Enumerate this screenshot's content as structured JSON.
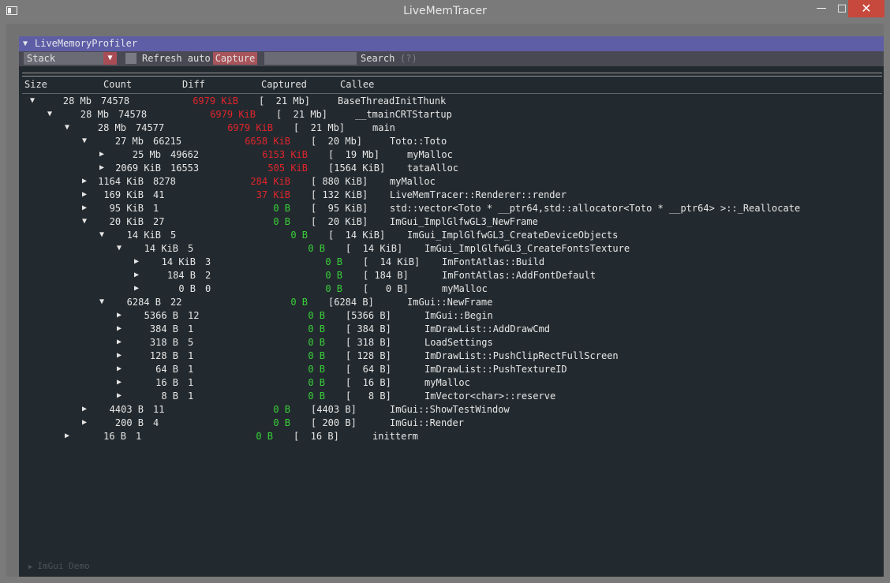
{
  "window": {
    "title": "LiveMemTracer",
    "minimize_icon": "minimize-icon",
    "maximize_icon": "maximize-icon",
    "close_icon": "close-icon"
  },
  "panel": {
    "title": "LiveMemoryProfiler",
    "collapse_icon": "triangle-down-icon"
  },
  "toolbar": {
    "stack_value": "Stack",
    "refresh_label": "Refresh auto",
    "refresh_checked": false,
    "capture_label": "Capture",
    "search_value": "",
    "search_label": "Search",
    "search_help": "(?)"
  },
  "columns": [
    "Size",
    "Count",
    "Diff",
    "Captured",
    "Callee"
  ],
  "colors": {
    "negative": "#e0242c",
    "zero": "#38d038",
    "header": "#5e5ea6",
    "capture": "#a8545b"
  },
  "rows": [
    {
      "depth": 0,
      "expanded": true,
      "size": "28 Mb",
      "count": "74578",
      "diff": "6979 KiB",
      "diff_kind": "neg",
      "captured": "[  21 Mb]",
      "callee": "BaseThreadInitThunk"
    },
    {
      "depth": 1,
      "expanded": true,
      "size": "28 Mb",
      "count": "74578",
      "diff": "6979 KiB",
      "diff_kind": "neg",
      "captured": "[  21 Mb]",
      "callee": "__tmainCRTStartup"
    },
    {
      "depth": 2,
      "expanded": true,
      "size": "28 Mb",
      "count": "74577",
      "diff": "6979 KiB",
      "diff_kind": "neg",
      "captured": "[  21 Mb]",
      "callee": "main"
    },
    {
      "depth": 3,
      "expanded": true,
      "size": "27 Mb",
      "count": "66215",
      "diff": "6658 KiB",
      "diff_kind": "neg",
      "captured": "[  20 Mb]",
      "callee": "Toto::Toto"
    },
    {
      "depth": 4,
      "expanded": false,
      "size": "25 Mb",
      "count": "49662",
      "diff": "6153 KiB",
      "diff_kind": "neg",
      "captured": "[  19 Mb]",
      "callee": "myMalloc"
    },
    {
      "depth": 4,
      "expanded": false,
      "size": "2069 KiB",
      "count": "16553",
      "diff": "505 KiB",
      "diff_kind": "neg",
      "captured": "[1564 KiB]",
      "callee": "tataAlloc"
    },
    {
      "depth": 3,
      "expanded": false,
      "size": "1164 KiB",
      "count": "8278",
      "diff": "284 KiB",
      "diff_kind": "neg",
      "captured": "[ 880 KiB]",
      "callee": "myMalloc"
    },
    {
      "depth": 3,
      "expanded": false,
      "size": "169 KiB",
      "count": "41",
      "diff": "37 KiB",
      "diff_kind": "neg",
      "captured": "[ 132 KiB]",
      "callee": "LiveMemTracer::Renderer::render"
    },
    {
      "depth": 3,
      "expanded": false,
      "size": "95 KiB",
      "count": "1",
      "diff": "0 B",
      "diff_kind": "pos",
      "captured": "[  95 KiB]",
      "callee": "std::vector<Toto * __ptr64,std::allocator<Toto * __ptr64> >::_Reallocate"
    },
    {
      "depth": 3,
      "expanded": true,
      "size": "20 KiB",
      "count": "27",
      "diff": "0 B",
      "diff_kind": "pos",
      "captured": "[  20 KiB]",
      "callee": "ImGui_ImplGlfwGL3_NewFrame"
    },
    {
      "depth": 4,
      "expanded": true,
      "size": "14 KiB",
      "count": "5",
      "diff": "0 B",
      "diff_kind": "pos",
      "captured": "[  14 KiB]",
      "callee": "ImGui_ImplGlfwGL3_CreateDeviceObjects"
    },
    {
      "depth": 5,
      "expanded": true,
      "size": "14 KiB",
      "count": "5",
      "diff": "0 B",
      "diff_kind": "pos",
      "captured": "[  14 KiB]",
      "callee": "ImGui_ImplGlfwGL3_CreateFontsTexture"
    },
    {
      "depth": 6,
      "expanded": false,
      "size": "14 KiB",
      "count": "3",
      "diff": "0 B",
      "diff_kind": "pos",
      "captured": "[  14 KiB]",
      "callee": "ImFontAtlas::Build"
    },
    {
      "depth": 6,
      "expanded": false,
      "size": "184 B",
      "count": "2",
      "diff": "0 B",
      "diff_kind": "pos",
      "captured": "[ 184 B]",
      "callee": "ImFontAtlas::AddFontDefault"
    },
    {
      "depth": 6,
      "expanded": false,
      "size": "0 B",
      "count": "0",
      "diff": "0 B",
      "diff_kind": "pos",
      "captured": "[   0 B]",
      "callee": "myMalloc"
    },
    {
      "depth": 4,
      "expanded": true,
      "size": "6284 B",
      "count": "22",
      "diff": "0 B",
      "diff_kind": "pos",
      "captured": "[6284 B]",
      "callee": "ImGui::NewFrame"
    },
    {
      "depth": 5,
      "expanded": false,
      "size": "5366 B",
      "count": "12",
      "diff": "0 B",
      "diff_kind": "pos",
      "captured": "[5366 B]",
      "callee": "ImGui::Begin"
    },
    {
      "depth": 5,
      "expanded": false,
      "size": "384 B",
      "count": "1",
      "diff": "0 B",
      "diff_kind": "pos",
      "captured": "[ 384 B]",
      "callee": "ImDrawList::AddDrawCmd"
    },
    {
      "depth": 5,
      "expanded": false,
      "size": "318 B",
      "count": "5",
      "diff": "0 B",
      "diff_kind": "pos",
      "captured": "[ 318 B]",
      "callee": "LoadSettings"
    },
    {
      "depth": 5,
      "expanded": false,
      "size": "128 B",
      "count": "1",
      "diff": "0 B",
      "diff_kind": "pos",
      "captured": "[ 128 B]",
      "callee": "ImDrawList::PushClipRectFullScreen"
    },
    {
      "depth": 5,
      "expanded": false,
      "size": "64 B",
      "count": "1",
      "diff": "0 B",
      "diff_kind": "pos",
      "captured": "[  64 B]",
      "callee": "ImDrawList::PushTextureID"
    },
    {
      "depth": 5,
      "expanded": false,
      "size": "16 B",
      "count": "1",
      "diff": "0 B",
      "diff_kind": "pos",
      "captured": "[  16 B]",
      "callee": "myMalloc"
    },
    {
      "depth": 5,
      "expanded": false,
      "size": "8 B",
      "count": "1",
      "diff": "0 B",
      "diff_kind": "pos",
      "captured": "[   8 B]",
      "callee": "ImVector<char>::reserve"
    },
    {
      "depth": 3,
      "expanded": false,
      "size": "4403 B",
      "count": "11",
      "diff": "0 B",
      "diff_kind": "pos",
      "captured": "[4403 B]",
      "callee": "ImGui::ShowTestWindow"
    },
    {
      "depth": 3,
      "expanded": false,
      "size": "200 B",
      "count": "4",
      "diff": "0 B",
      "diff_kind": "pos",
      "captured": "[ 200 B]",
      "callee": "ImGui::Render"
    },
    {
      "depth": 2,
      "expanded": false,
      "size": "16 B",
      "count": "1",
      "diff": "0 B",
      "diff_kind": "pos",
      "captured": "[  16 B]",
      "callee": "initterm"
    }
  ],
  "demo": {
    "label": "ImGui Demo",
    "icon": "triangle-right-icon"
  }
}
